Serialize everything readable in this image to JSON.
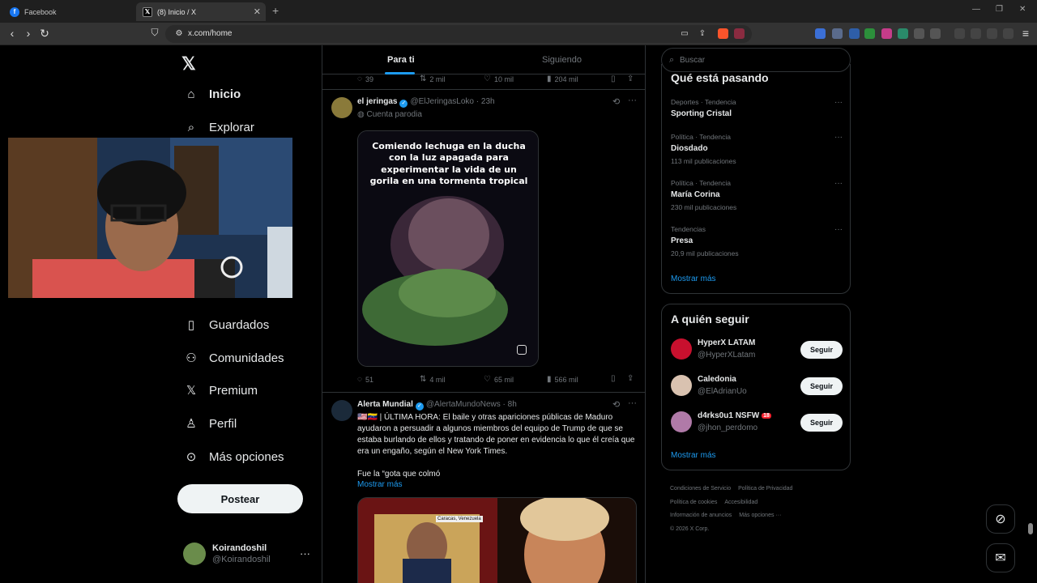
{
  "browser": {
    "tabs": [
      {
        "title": "Facebook",
        "icon": "facebook-icon"
      },
      {
        "title": "(8) Inicio / X",
        "icon": "x-logo-icon"
      }
    ],
    "url": "x.com/home"
  },
  "nav": {
    "items": [
      {
        "label": "Inicio",
        "icon": "home-icon"
      },
      {
        "label": "Explorar",
        "icon": "search-icon"
      },
      {
        "label": "Guardados",
        "icon": "bookmark-icon"
      },
      {
        "label": "Comunidades",
        "icon": "communities-icon"
      },
      {
        "label": "Premium",
        "icon": "x-logo-icon"
      },
      {
        "label": "Perfil",
        "icon": "person-icon"
      },
      {
        "label": "Más opciones",
        "icon": "more-circle-icon"
      }
    ],
    "post_label": "Postear",
    "account": {
      "name": "Koirandoshil",
      "handle": "@Koirandoshil"
    }
  },
  "feed": {
    "tabs": [
      "Para ti",
      "Siguiendo"
    ],
    "prev_actions": {
      "replies": "39",
      "reposts": "2 mil",
      "likes": "10 mil",
      "views": "204 mil"
    },
    "tweets": [
      {
        "name": "el jeringas",
        "handle": "@ElJeringasLoko",
        "time": "23h",
        "sub": "Cuenta parodia",
        "media_caption": "Comiendo lechuga en la ducha con la luz apagada para experimentar la vida de un gorila en una tormenta tropical",
        "actions": {
          "replies": "51",
          "reposts": "4 mil",
          "likes": "65 mil",
          "views": "566 mil"
        }
      },
      {
        "name": "Alerta Mundial",
        "handle": "@AlertaMundoNews",
        "time": "8h",
        "text": "🇺🇸🇻🇪 | ÚLTIMA HORA: El baile y otras apariciones públicas de Maduro ayudaron a persuadir a algunos miembros del equipo de Trump de que se estaba burlando de ellos y tratando de poner en evidencia lo que él creía que era un engaño, según el New York Times.",
        "text2": "Fue la “gota que colmó",
        "show_more": "Mostrar más",
        "media_label": "Caracas, Venezuela"
      }
    ]
  },
  "sidebar": {
    "search_placeholder": "Buscar",
    "trends_title": "Qué está pasando",
    "trends": [
      {
        "category": "Deportes · Tendencia",
        "name": "Sporting Cristal",
        "count": ""
      },
      {
        "category": "Política · Tendencia",
        "name": "Diosdado",
        "count": "113 mil publicaciones"
      },
      {
        "category": "Política · Tendencia",
        "name": "María Corina",
        "count": "230 mil publicaciones"
      },
      {
        "category": "Tendencias",
        "name": "Presa",
        "count": "20,9 mil publicaciones"
      }
    ],
    "trends_more": "Mostrar más",
    "follow_title": "A quién seguir",
    "follow": [
      {
        "name": "HyperX LATAM",
        "handle": "@HyperXLatam",
        "button": "Seguir",
        "badge": ""
      },
      {
        "name": "Caledonia",
        "handle": "@ElAdrianUo",
        "button": "Seguir",
        "badge": ""
      },
      {
        "name": "d4rks0u1 NSFW",
        "handle": "@jhon_perdomo",
        "button": "Seguir",
        "badge": "18"
      }
    ],
    "follow_more": "Mostrar más",
    "footer": [
      "Condiciones de Servicio",
      "Política de Privacidad",
      "Política de cookies",
      "Accesibilidad",
      "Información de anuncios",
      "Más opciones ···",
      "© 2026 X Corp."
    ]
  }
}
